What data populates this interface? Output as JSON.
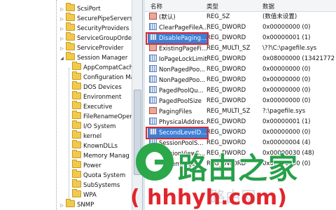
{
  "tree": {
    "items": [
      {
        "label": "ScsiPort",
        "level": 1
      },
      {
        "label": "SecurePipeServers",
        "level": 1
      },
      {
        "label": "SecurityProviders",
        "level": 1
      },
      {
        "label": "ServiceGroupOrder",
        "level": 1
      },
      {
        "label": "ServiceProvider",
        "level": 1
      },
      {
        "label": "Session Manager",
        "level": 1,
        "expanded": true
      },
      {
        "label": "AppCompatCache",
        "level": 2
      },
      {
        "label": "Configuration Manag",
        "level": 2
      },
      {
        "label": "DOS Devices",
        "level": 2
      },
      {
        "label": "Environment",
        "level": 2
      },
      {
        "label": "Executive",
        "level": 2
      },
      {
        "label": "FileRenameOperatio",
        "level": 2
      },
      {
        "label": "I/O System",
        "level": 2
      },
      {
        "label": "kernel",
        "level": 2
      },
      {
        "label": "KnownDLLs",
        "level": 2
      },
      {
        "label": "Memory Manag",
        "level": 2
      },
      {
        "label": "Power",
        "level": 2
      },
      {
        "label": "Quota System",
        "level": 2
      },
      {
        "label": "SubSystems",
        "level": 2
      },
      {
        "label": "WPA",
        "level": 2
      },
      {
        "label": "SNMP",
        "level": 1
      }
    ]
  },
  "list": {
    "headers": {
      "name": "名称",
      "type": "类型",
      "data": "数据"
    },
    "rows": [
      {
        "name": "(默认)",
        "type": "REG_SZ",
        "data": "(数值未设置)",
        "kind": "sz"
      },
      {
        "name": "ClearPageFileA...",
        "type": "REG_DWORD",
        "data": "0x00000000 (0)",
        "kind": "dword"
      },
      {
        "name": "DisablePaging...",
        "type": "REG_DWORD",
        "data": "0x00000001 (1)",
        "kind": "dword",
        "boxed": true,
        "selected": true
      },
      {
        "name": "ExistingPageFi...",
        "type": "REG_MULTI_SZ",
        "data": "\\??\\C:\\pagefile.sys",
        "kind": "sz"
      },
      {
        "name": "IoPageLockLimit",
        "type": "REG_DWORD",
        "data": "0x08000000 (13421772",
        "kind": "dword"
      },
      {
        "name": "NonPagedPoo...",
        "type": "REG_DWORD",
        "data": "0x00000000 (0)",
        "kind": "dword"
      },
      {
        "name": "NonPagedPoo...",
        "type": "REG_DWORD",
        "data": "0x00000000 (0)",
        "kind": "dword"
      },
      {
        "name": "PagedPoolQu...",
        "type": "REG_DWORD",
        "data": "0x00000000 (0)",
        "kind": "dword"
      },
      {
        "name": "PagedPoolSize",
        "type": "REG_DWORD",
        "data": "0x00000000 (0)",
        "kind": "dword"
      },
      {
        "name": "PagingFiles",
        "type": "REG_MULTI_SZ",
        "data": "?:\\pagefile.sys",
        "kind": "sz"
      },
      {
        "name": "PhysicalAddres...",
        "type": "REG_DWORD",
        "data": "0x00000001 (1)",
        "kind": "dword"
      },
      {
        "name": "SecondLevelD...",
        "type": "REG_DWORD",
        "data": "0x00000000 (0)",
        "kind": "dword",
        "boxed": true,
        "selected": true
      },
      {
        "name": "SessionPoolS...",
        "type": "REG_DWORD",
        "data": "0x00000004 (4)",
        "kind": "dword"
      },
      {
        "name": "SessionViewS...",
        "type": "REG_DWORD",
        "data": "0x00000030 (48)",
        "kind": "dword"
      },
      {
        "name": "SystemPages",
        "type": "REG_DWORD",
        "data": "0x00000000 (0)",
        "kind": "dword"
      }
    ]
  },
  "watermark": {
    "brand": "路由之家",
    "url": "( hhhyh.com)",
    "faint": "路由网"
  },
  "colors": {
    "selection": "#3c7fd6",
    "highlight_box": "#e2252c",
    "brand_green": "#27a04a"
  }
}
